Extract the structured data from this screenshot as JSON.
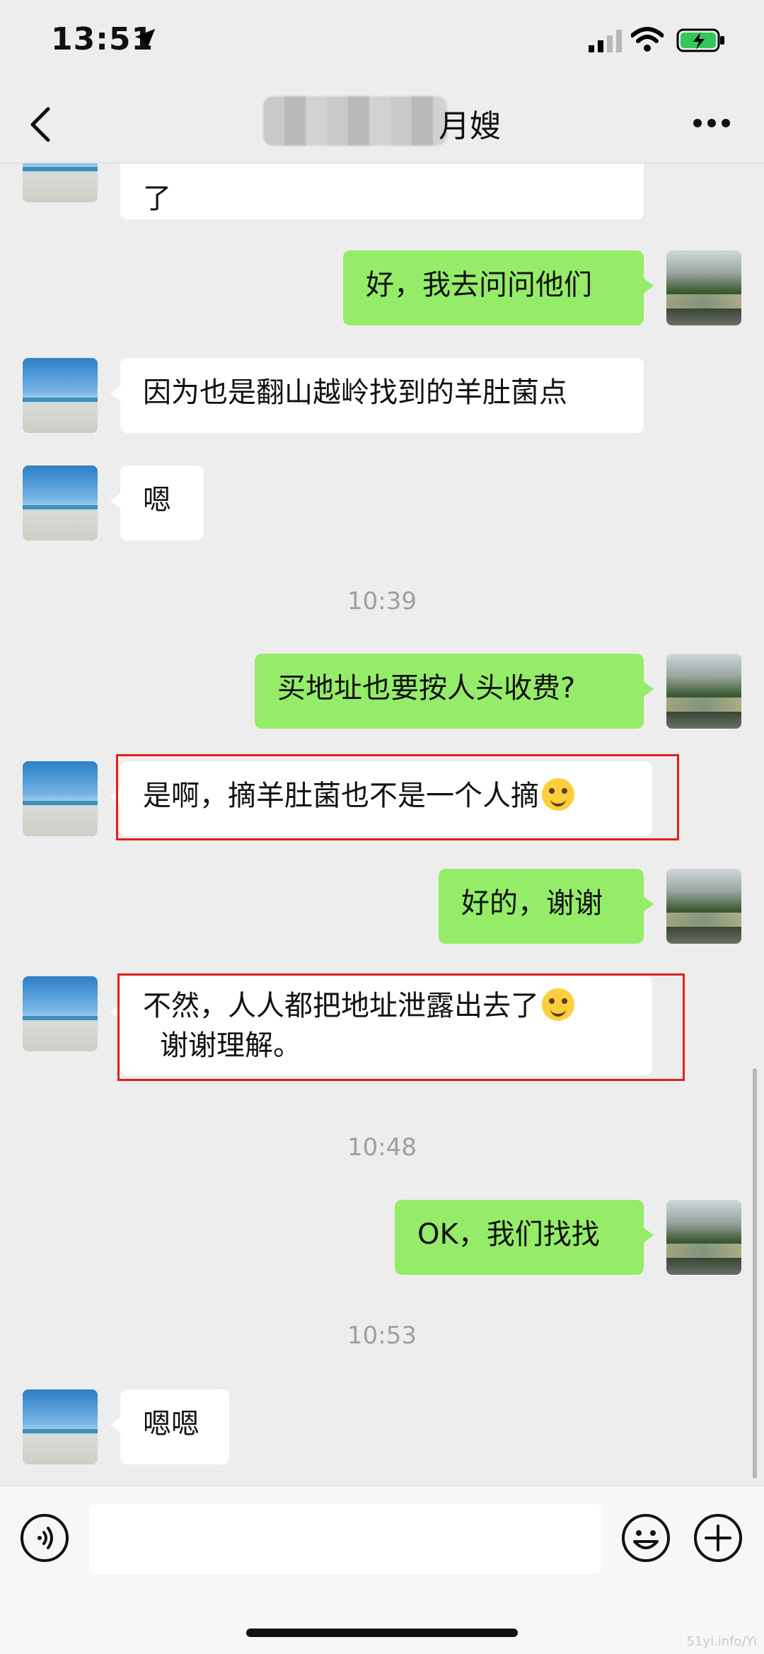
{
  "status": {
    "time": "13:51"
  },
  "nav": {
    "title": "月嫂"
  },
  "messages": [
    {
      "side": "in",
      "text": "了"
    },
    {
      "side": "out",
      "text": "好，我去问问他们"
    },
    {
      "side": "in",
      "text": "因为也是翻山越岭找到的羊肚菌点"
    },
    {
      "side": "in",
      "text": "嗯"
    },
    {
      "time": "10:39"
    },
    {
      "side": "out",
      "text": "买地址也要按人头收费?"
    },
    {
      "side": "in",
      "text": "是啊，摘羊肚菌也不是一个人摘",
      "emoji": "tears-of-joy",
      "highlighted": true
    },
    {
      "side": "out",
      "text": "好的，谢谢"
    },
    {
      "side": "in",
      "line1": "不然，人人都把地址泄露出去了",
      "line2": "谢谢理解。",
      "emoji": "smile",
      "highlighted": true
    },
    {
      "time": "10:48"
    },
    {
      "side": "out",
      "text": "OK，我们找找"
    },
    {
      "time": "10:53"
    },
    {
      "side": "in",
      "text": "嗯嗯"
    }
  ],
  "watermark": "51yi.info/Yi",
  "colors": {
    "background": "#ededed",
    "outgoing": "#95ec69",
    "incoming": "#ffffff",
    "highlight": "#e0201b"
  }
}
